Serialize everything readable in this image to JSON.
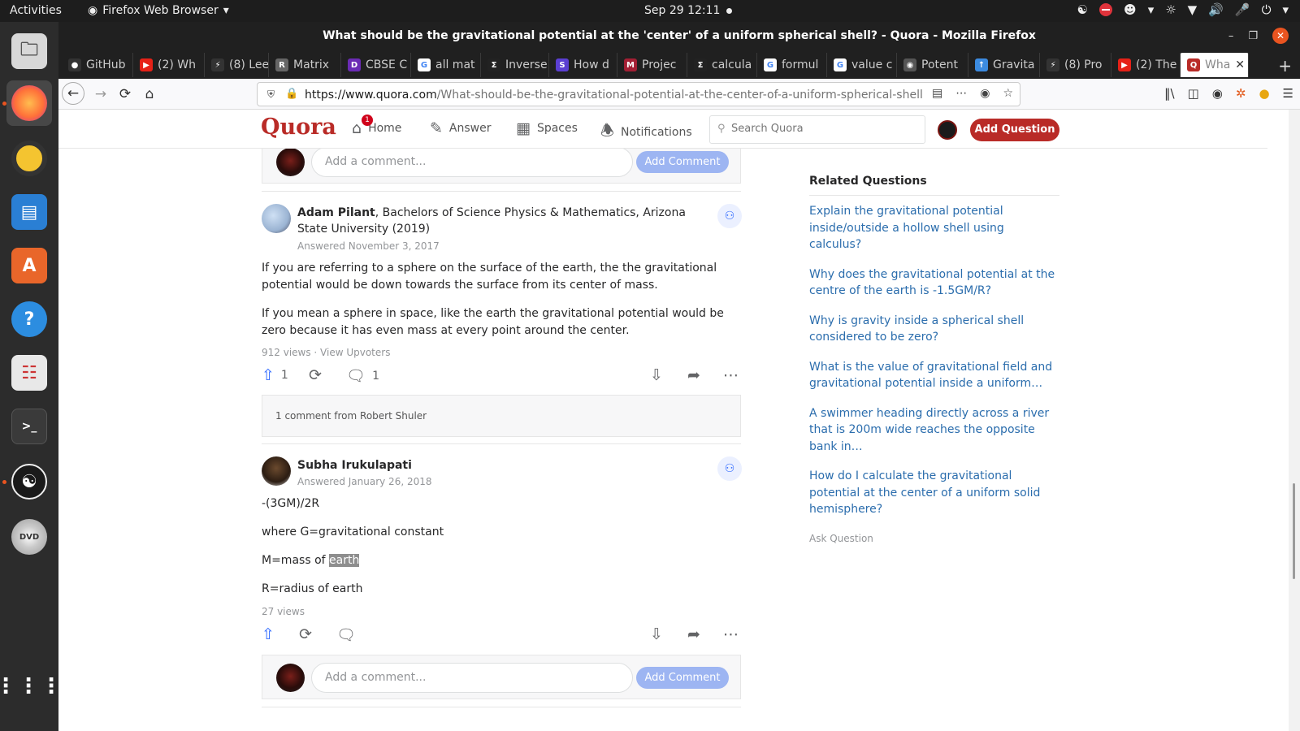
{
  "os": {
    "activities": "Activities",
    "app_name": "Firefox Web Browser",
    "clock": "Sep 29  12:11"
  },
  "window": {
    "title": "What should be the gravitational potential at the 'center' of a uniform spherical shell? - Quora - Mozilla Firefox"
  },
  "tabs": [
    {
      "label": "GitHub",
      "favicon": "github",
      "color": "#333333"
    },
    {
      "label": "(2) Wh",
      "favicon": "youtube",
      "color": "#e62117"
    },
    {
      "label": "(8) Lee",
      "favicon": "bolt",
      "color": "#333333"
    },
    {
      "label": "Matrix",
      "favicon": "R",
      "color": "#666666"
    },
    {
      "label": "CBSE C",
      "favicon": "D",
      "color": "#6b2bb5"
    },
    {
      "label": "all mat",
      "favicon": "google",
      "color": "#4285f4"
    },
    {
      "label": "Inverse",
      "favicon": "sigma",
      "color": "#222222"
    },
    {
      "label": "How d",
      "favicon": "S",
      "color": "#5b3fd2"
    },
    {
      "label": "Projec",
      "favicon": "MIT",
      "color": "#a31f34"
    },
    {
      "label": "calcula",
      "favicon": "sigma",
      "color": "#222222"
    },
    {
      "label": "formul",
      "favicon": "google",
      "color": "#4285f4"
    },
    {
      "label": "value c",
      "favicon": "google",
      "color": "#4285f4"
    },
    {
      "label": "Potent",
      "favicon": "owl",
      "color": "#555555"
    },
    {
      "label": "Gravita",
      "favicon": "up",
      "color": "#3c8be0"
    },
    {
      "label": "(8) Pro",
      "favicon": "bolt",
      "color": "#333333"
    },
    {
      "label": "(2) The",
      "favicon": "youtube",
      "color": "#e62117"
    },
    {
      "label": "Wha",
      "favicon": "Q",
      "color": "#b92b27"
    }
  ],
  "url": {
    "domain": "https://www.quora.com",
    "path": "/What-should-be-the-gravitational-potential-at-the-center-of-a-uniform-spherical-shell"
  },
  "quora": {
    "logo": "Quora",
    "nav": {
      "home": "Home",
      "home_badge": "1",
      "answer": "Answer",
      "spaces": "Spaces",
      "notifications": "Notifications"
    },
    "search_placeholder": "Search Quora",
    "add_question": "Add Question",
    "comment_placeholder": "Add a comment...",
    "add_comment": "Add Comment"
  },
  "answers": [
    {
      "author": "Adam Pilant",
      "credential": ", Bachelors of Science Physics & Mathematics, Arizona State University (2019)",
      "date": "Answered November 3, 2017",
      "paragraphs": [
        "If you are referring to a sphere on the surface of the earth, the the gravitational potential would be down towards the surface from its center of mass.",
        "If you mean a sphere in space, like the earth the gravitational potential would be zero because it has even mass at every point around the center."
      ],
      "views": "912 views · View Upvoters",
      "upvotes": "1",
      "comments": "1",
      "comment_preview": "1 comment from Robert Shuler"
    },
    {
      "author": "Subha Irukulapati",
      "date": "Answered January 26, 2018",
      "paragraphs": [
        "-(3GM)/2R",
        "where G=gravitational constant",
        "M=mass of ",
        "R=radius of earth"
      ],
      "highlight": "earth",
      "views": "27 views"
    }
  ],
  "related": {
    "heading": "Related Questions",
    "items": [
      "Explain the gravitational potential inside/outside a hollow shell using calculus?",
      "Why does the gravitational potential at the centre of the earth is -1.5GM/R?",
      "Why is gravity inside a spherical shell considered to be zero?",
      "What is the value of gravitational field and gravitational potential inside a uniform…",
      "A swimmer heading directly across a river that is 200m wide reaches the opposite bank in…",
      "How do I calculate the gravitational potential at the center of a uniform solid hemisphere?"
    ],
    "ask": "Ask Question"
  }
}
